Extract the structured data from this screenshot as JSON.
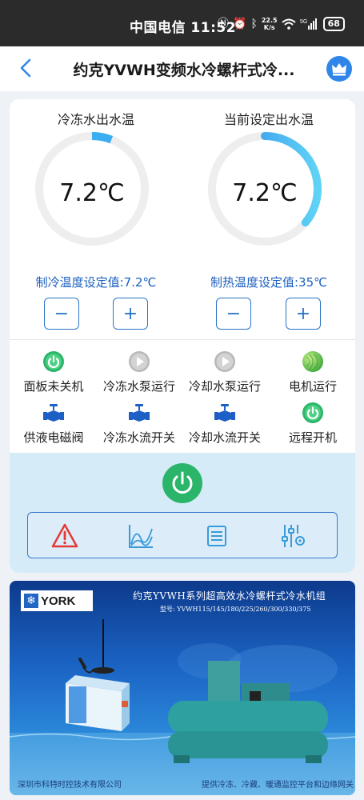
{
  "status_bar": {
    "carrier_time": "中国电信 11:52",
    "speed_top": "22.5",
    "speed_bottom": "K/s",
    "battery": "68"
  },
  "nav": {
    "title": "约克YVWH变频水冷螺杆式冷...",
    "back_icon": "chevron-left-icon",
    "crown_icon": "crown-icon"
  },
  "gauges": [
    {
      "label": "冷冻水出水温",
      "value": "7.2℃",
      "fill_fraction": 0.06
    },
    {
      "label": "当前设定出水温",
      "value": "7.2℃",
      "fill_fraction": 0.36
    }
  ],
  "setpoints": {
    "cooling": "制冷温度设定值:7.2℃",
    "heating": "制热温度设定值:35℃",
    "minus": "−",
    "plus": "+"
  },
  "status_items": [
    {
      "label": "面板未关机",
      "icon": "power-on-icon"
    },
    {
      "label": "冷冻水泵运行",
      "icon": "play-icon"
    },
    {
      "label": "冷却水泵运行",
      "icon": "play-icon"
    },
    {
      "label": "电机运行",
      "icon": "motor-icon"
    },
    {
      "label": "供液电磁阀",
      "icon": "valve-icon"
    },
    {
      "label": "冷冻水流开关",
      "icon": "valve-icon"
    },
    {
      "label": "冷却水流开关",
      "icon": "valve-icon"
    },
    {
      "label": "远程开机",
      "icon": "power-on-icon"
    }
  ],
  "toolbar": {
    "tools": [
      "alarm-icon",
      "trend-chart-icon",
      "list-icon",
      "settings-sliders-icon"
    ]
  },
  "colors": {
    "accent_blue": "#2a73c8",
    "power_green": "#2bb56a",
    "gauge_track": "#eeeeee"
  },
  "banner": {
    "logo": "YORK",
    "title": "约克YVWH系列超高效水冷螺杆式冷水机组",
    "models": "型号: YVWH115/145/180/225/260/300/330/375",
    "footer_left": "深圳市科特时控技术有限公司",
    "footer_right": "提供冷冻、冷藏、暖通监控平台和边缘网关"
  }
}
